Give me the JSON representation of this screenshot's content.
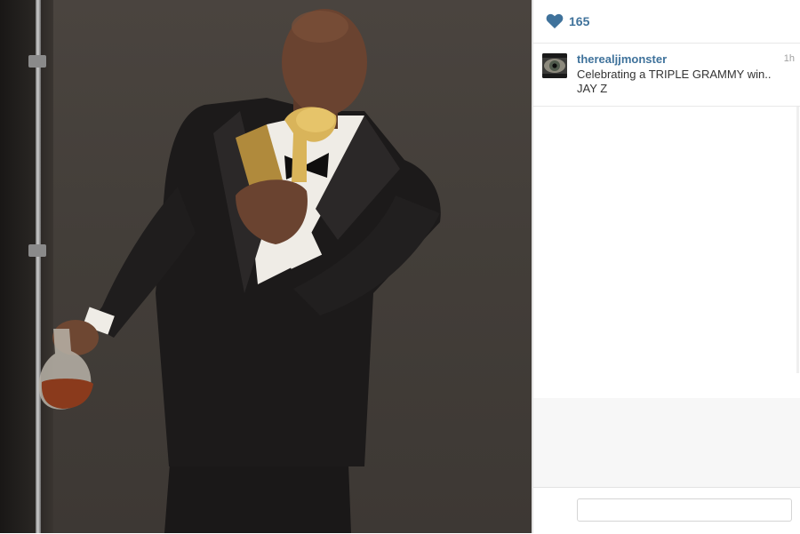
{
  "post": {
    "photo_icon": "photo-of-man-in-tuxedo-drinking-from-grammy",
    "likes_count": "165",
    "comment": {
      "username": "therealjjmonster",
      "timestamp": "1h",
      "caption_line1": "Celebrating a TRIPLE GRAMMY win..",
      "caption_line2": "JAY Z"
    },
    "comment_input": {
      "placeholder": ""
    }
  },
  "colors": {
    "link_blue": "#3f729b",
    "timestamp_gray": "#a0a0a0",
    "caption_text": "#333333"
  },
  "icons": {
    "like": "heart-icon",
    "avatar": "eye-avatar-icon"
  }
}
